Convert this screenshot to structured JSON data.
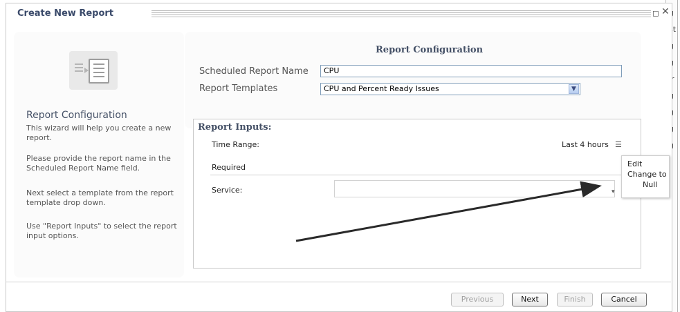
{
  "dialog": {
    "title": "Create New Report",
    "maximize_glyph": "◻",
    "close_glyph": "✕"
  },
  "background_right_chars": [
    "g",
    "st",
    "g",
    "g",
    "ir",
    "g",
    "g",
    "g",
    "g"
  ],
  "left_panel": {
    "heading": "Report Configuration",
    "paragraphs": [
      "This wizard will help you create a new report.",
      "Please provide the report name in the Scheduled Report Name field.",
      "Next select a template from the report template drop down.",
      "Use \"Report Inputs\" to select the report input options."
    ]
  },
  "config": {
    "heading": "Report Configuration",
    "name_label": "Scheduled Report Name",
    "name_value": "CPU",
    "templates_label": "Report Templates",
    "template_value": "CPU and Percent Ready Issues"
  },
  "report_inputs": {
    "title": "Report Inputs:",
    "time_range_label": "Time Range:",
    "time_range_value": "Last 4 hours",
    "required_label": "Required",
    "service_label": "Service:",
    "service_value": ""
  },
  "context_menu": {
    "items": [
      "Edit",
      "Change to",
      "Null"
    ]
  },
  "footer": {
    "previous": "Previous",
    "next": "Next",
    "finish": "Finish",
    "cancel": "Cancel"
  }
}
